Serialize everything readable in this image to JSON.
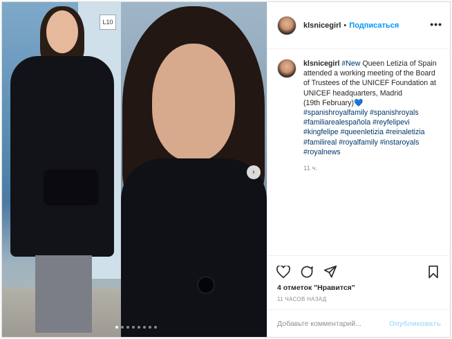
{
  "post": {
    "username": "klsnicegirl",
    "separator": "•",
    "follow_label": "Подписаться",
    "more_label": "•••",
    "sign_text": "L10",
    "next_label": "›",
    "dots": [
      1,
      0,
      0,
      0,
      0,
      0,
      0,
      0
    ],
    "caption": {
      "username": "klsnicegirl",
      "tag_new": "#New",
      "text": " Queen Letizia of Spain attended a working meeting of the Board of Trustees of the UNICEF Foundation at UNICEF headquarters, Madrid",
      "date_line": "(19th February)",
      "heart": "💙",
      "hashtags": [
        "#spanishroyalfamily",
        "#spanishroyals",
        "#familiarealespañola",
        "#reyfelipevi",
        "#kingfelipe",
        "#queenletizia",
        "#reinaletizia",
        "#familireal",
        "#royalfamily",
        "#instaroyals",
        "#royalnews"
      ],
      "time": "11 ч."
    },
    "actions": {
      "likes": "4 отметок \"Нравится\"",
      "date": "11 ЧАСОВ НАЗАД"
    },
    "comment": {
      "placeholder": "Добавьте комментарий...",
      "publish_label": "Опубликовать"
    },
    "icons": [
      "heart-icon",
      "comment-icon",
      "share-icon",
      "bookmark-icon",
      "more-icon",
      "chevron-right-icon"
    ],
    "colors": {
      "link": "#0095f6",
      "hashtag": "#00376b",
      "muted": "#8e8e8e",
      "publish_disabled": "#b2dffc"
    }
  }
}
